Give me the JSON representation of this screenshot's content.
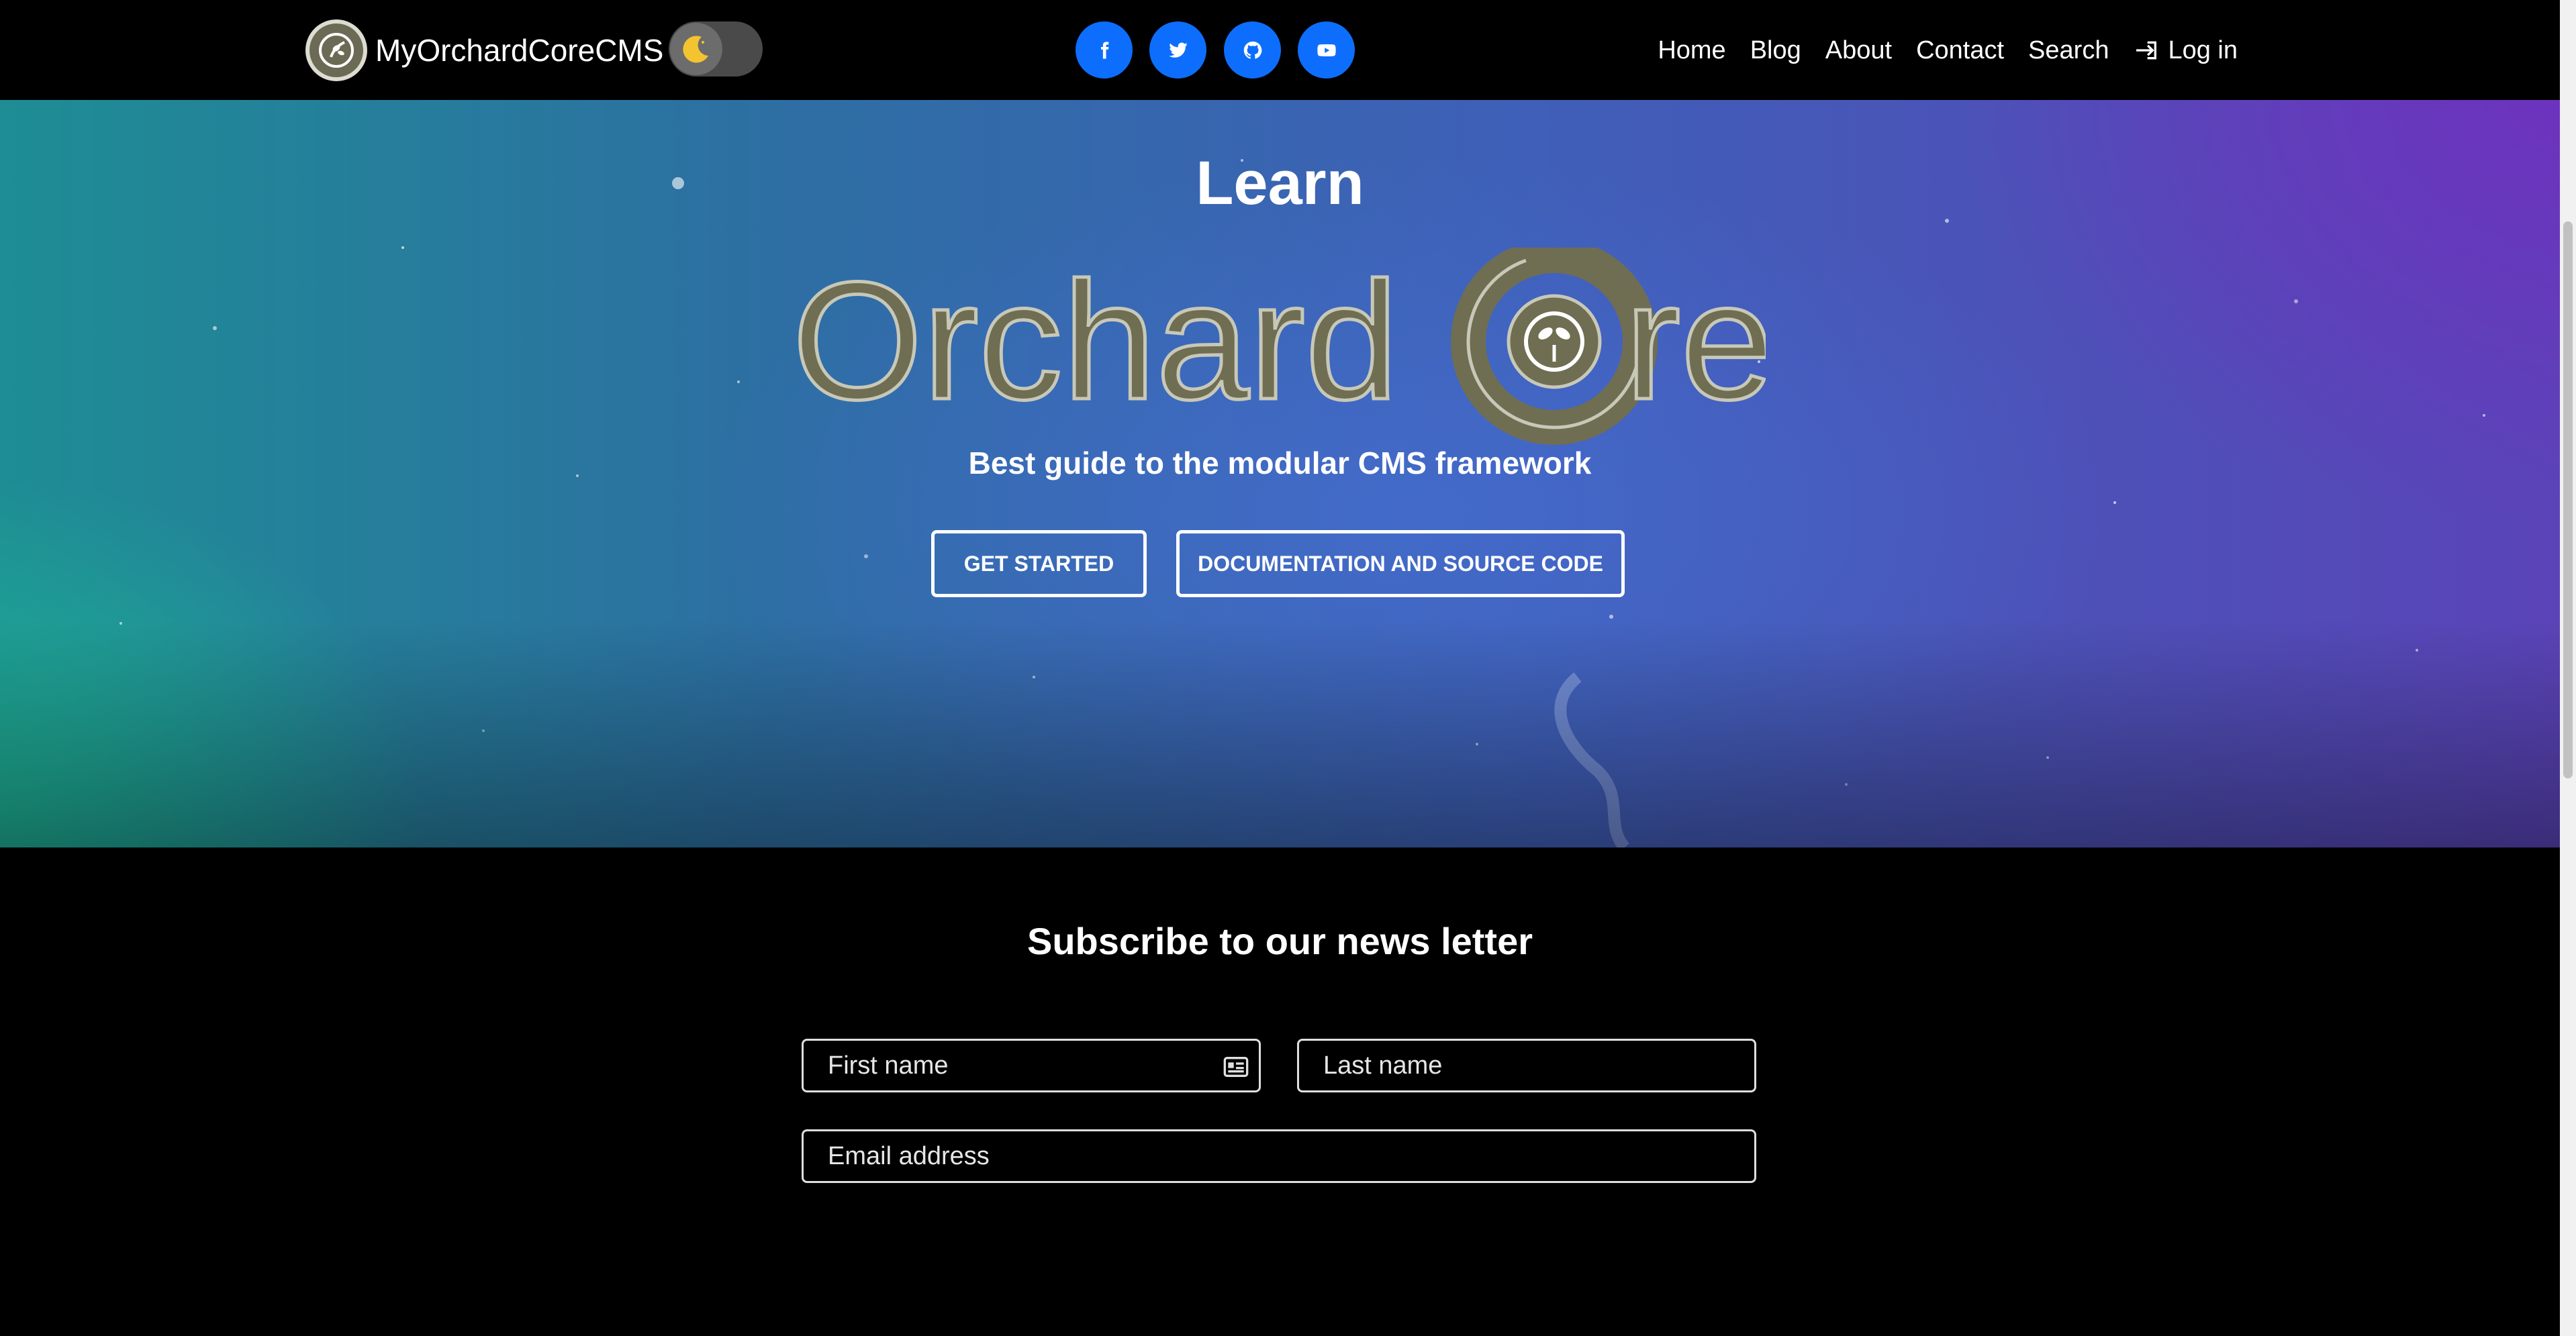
{
  "navbar": {
    "brand_name": "MyOrchardCoreCMS",
    "links": [
      {
        "label": "Home"
      },
      {
        "label": "Blog"
      },
      {
        "label": "About"
      },
      {
        "label": "Contact"
      },
      {
        "label": "Search"
      },
      {
        "label": "Log in",
        "icon": "login-icon"
      }
    ],
    "social_icons": [
      "facebook-icon",
      "twitter-icon",
      "github-icon",
      "youtube-icon"
    ],
    "social_color": "#0d6efd"
  },
  "hero": {
    "title": "Learn",
    "logo_text": "OrchardCore",
    "subtitle": "Best guide to the modular CMS framework",
    "buttons": {
      "get_started": "GET STARTED",
      "docs": "DOCUMENTATION AND SOURCE CODE"
    },
    "logo_color": "#6f6e52"
  },
  "subscribe": {
    "title": "Subscribe to our news letter",
    "first_name_placeholder": "First name",
    "last_name_placeholder": "Last name",
    "email_placeholder": "Email address"
  }
}
